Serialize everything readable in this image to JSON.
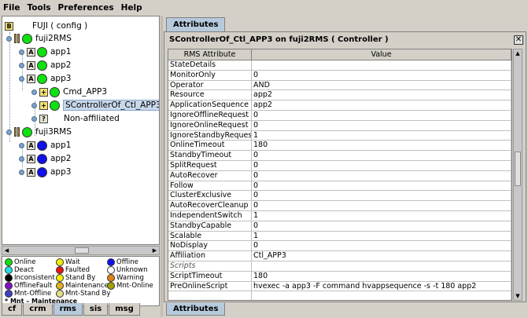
{
  "menu": [
    "File",
    "Tools",
    "Preferences",
    "Help"
  ],
  "tree": {
    "root": "FUJI ( config )",
    "nodes": [
      {
        "label": "fuji2RMS"
      },
      {
        "label": "app1"
      },
      {
        "label": "app2"
      },
      {
        "label": "app3"
      },
      {
        "label": "Cmd_APP3"
      },
      {
        "label": "SControllerOf_Ctl_APP3"
      },
      {
        "label": "Non-affiliated"
      },
      {
        "label": "fuji3RMS"
      },
      {
        "label": "app1"
      },
      {
        "label": "app2"
      },
      {
        "label": "app3"
      }
    ]
  },
  "legend": {
    "items": [
      {
        "label": "Online",
        "color": "#10e010"
      },
      {
        "label": "Wait",
        "color": "#f0f000"
      },
      {
        "label": "Offline",
        "color": "#1010e8"
      },
      {
        "label": "Deact",
        "color": "#20e0e0"
      },
      {
        "label": "Faulted",
        "color": "#e81010"
      },
      {
        "label": "Unknown",
        "color": "#ffffff"
      },
      {
        "label": "Inconsistent",
        "color": "#000000"
      },
      {
        "label": "Stand By",
        "color": "#f0f000"
      },
      {
        "label": "Warning",
        "color": "#e08010"
      },
      {
        "label": "OfflineFault",
        "color": "#8010c0"
      },
      {
        "label": "Maintenance",
        "color": "#e0b020"
      },
      {
        "label": "Mnt-Online",
        "color": "#a0a000"
      },
      {
        "label": "Mnt-Offline",
        "color": "#4040c0"
      },
      {
        "label": "Mnt-Stand By",
        "color": "#e0e080"
      }
    ],
    "note": "* Mnt – Maintenance"
  },
  "left_tabs": [
    "cf",
    "crm",
    "rms",
    "sis",
    "msg"
  ],
  "right": {
    "top_tab": "Attributes",
    "bottom_tab": "Attributes",
    "title": "SControllerOf_Ctl_APP3 on fuji2RMS ( Controller )",
    "columns": [
      "RMS Attribute",
      "Value"
    ],
    "rows": [
      [
        "StateDetails",
        ""
      ],
      [
        "MonitorOnly",
        "0"
      ],
      [
        "Operator",
        "AND"
      ],
      [
        "Resource",
        "app2"
      ],
      [
        "ApplicationSequence",
        "app2"
      ],
      [
        "IgnoreOfflineRequest",
        "0"
      ],
      [
        "IgnoreOnlineRequest",
        "0"
      ],
      [
        "IgnoreStandbyRequest",
        "1"
      ],
      [
        "OnlineTimeout",
        "180"
      ],
      [
        "StandbyTimeout",
        "0"
      ],
      [
        "SplitRequest",
        "0"
      ],
      [
        "AutoRecover",
        "0"
      ],
      [
        "Follow",
        "0"
      ],
      [
        "ClusterExclusive",
        "0"
      ],
      [
        "AutoRecoverCleanup",
        "0"
      ],
      [
        "IndependentSwitch",
        "1"
      ],
      [
        "StandbyCapable",
        "0"
      ],
      [
        "Scalable",
        "1"
      ],
      [
        "NoDisplay",
        "0"
      ],
      [
        "Affiliation",
        "Ctl_APP3"
      ],
      [
        "Scripts",
        ""
      ],
      [
        "ScriptTimeout",
        "180"
      ],
      [
        "PreOnlineScript",
        "hvexec -a app3 -F command hvappsequence -s -t 180 app2"
      ],
      [
        "",
        ""
      ]
    ]
  }
}
